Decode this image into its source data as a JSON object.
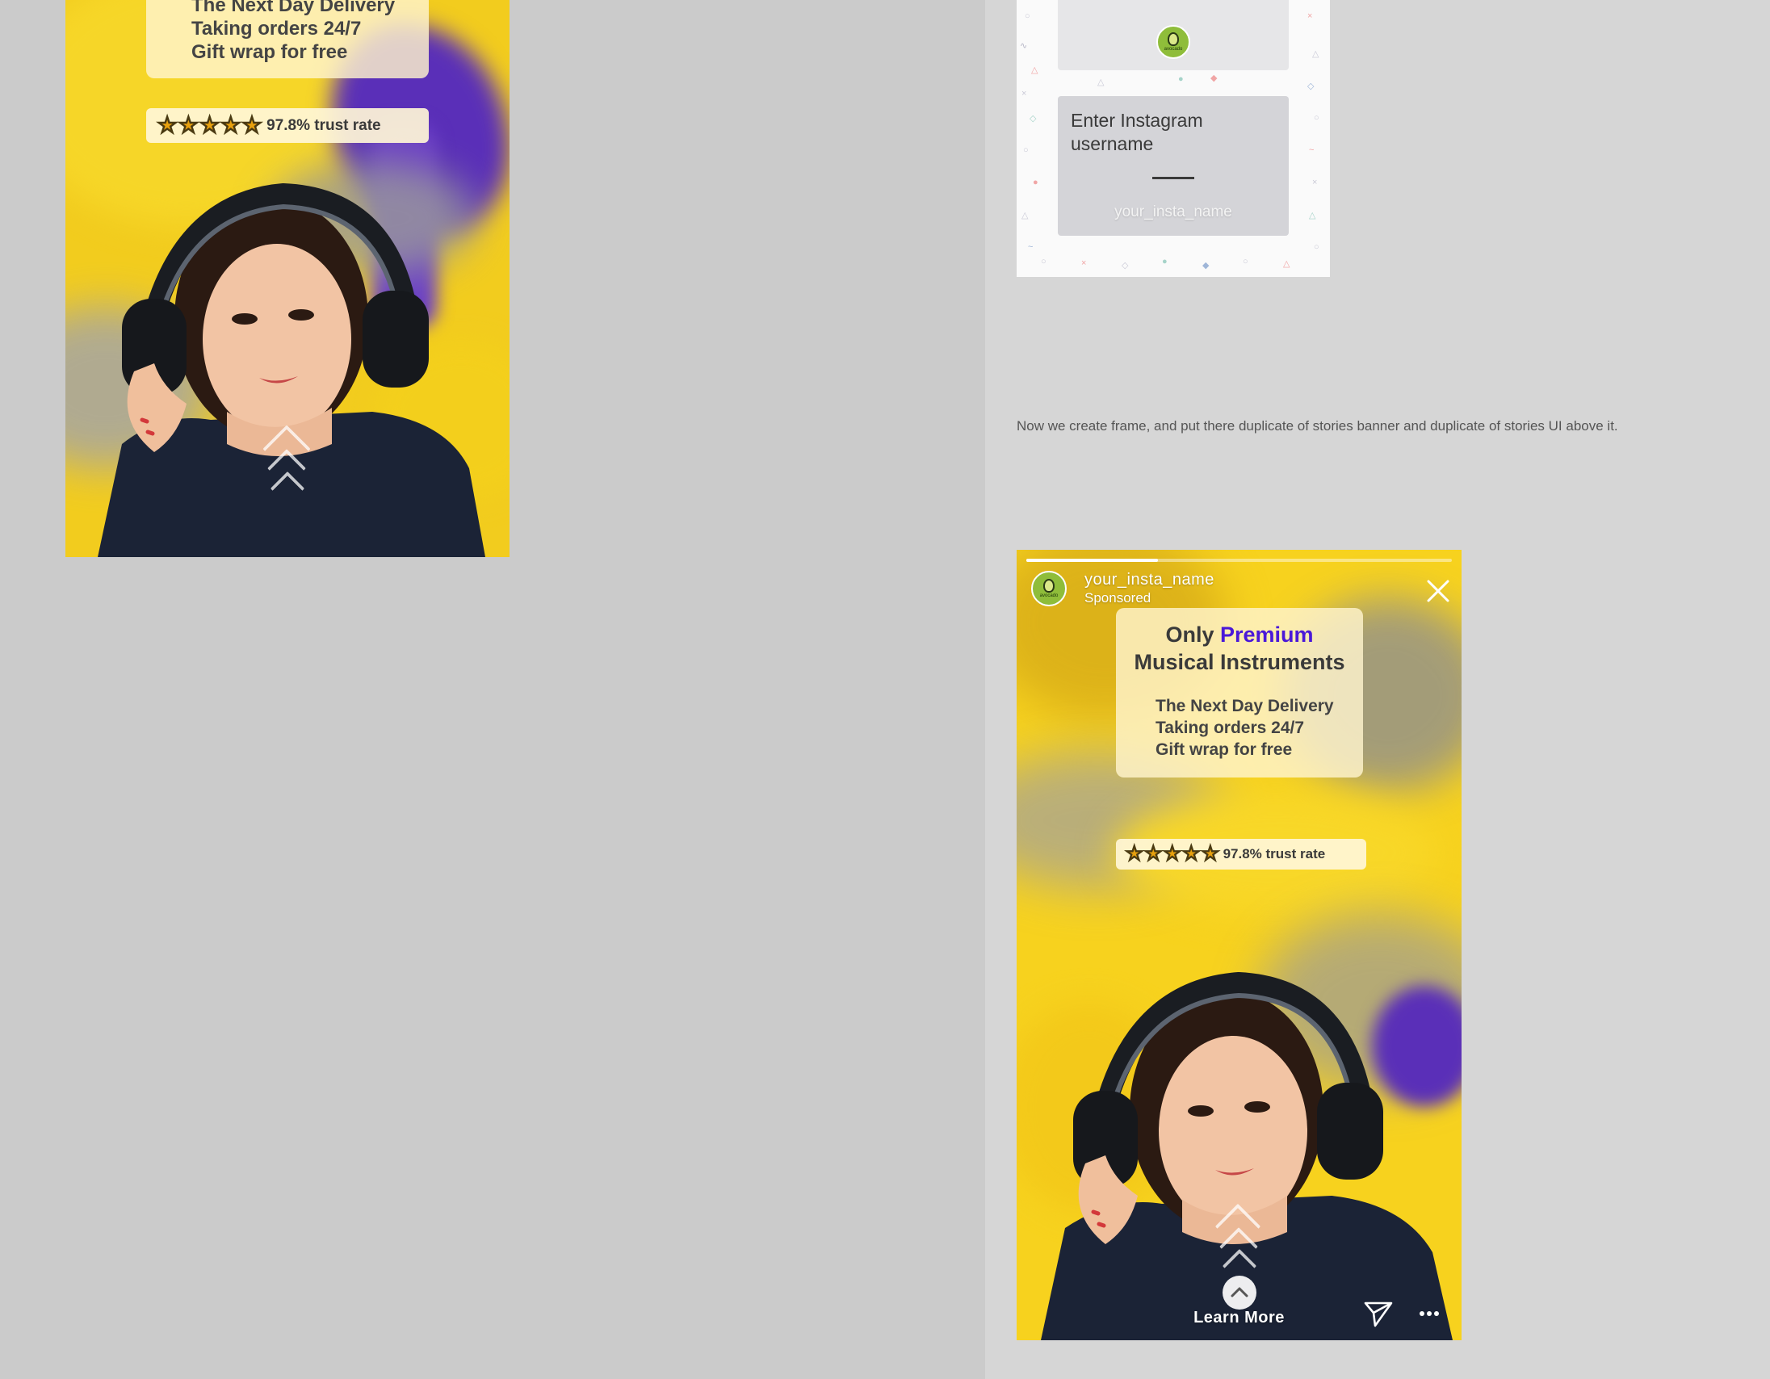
{
  "colors": {
    "canvas_bg": "#cbcbcb",
    "right_panel_bg": "#d6d6d6",
    "story_yellow": "#f7d21e",
    "accent_purple": "#4a18d8",
    "blob_purple": "#5a2fb8",
    "avocado_green": "#8fbd3a"
  },
  "left_banner": {
    "info_lines": [
      "The Next Day Delivery",
      "Taking orders 24/7",
      "Gift wrap for free"
    ],
    "stars": [
      "★",
      "★",
      "★",
      "★",
      "★"
    ],
    "trust_rate": "97.8% trust rate"
  },
  "top_phone": {
    "logo_text": "avocado",
    "prompt_label": "Enter Instagram username",
    "username_value": "your_insta_name"
  },
  "caption": "Now we create frame, and put there duplicate of stories banner and duplicate of stories UI above it.",
  "story": {
    "progress_fraction": 0.31,
    "avatar_logo_text": "avocado",
    "username": "your_insta_name",
    "sponsored": "Sponsored",
    "headline_only": "Only",
    "headline_premium": "Premium",
    "headline_line2": "Musical Instruments",
    "info_lines": [
      "The Next Day Delivery",
      "Taking orders 24/7",
      "Gift wrap for free"
    ],
    "stars": [
      "★",
      "★",
      "★",
      "★",
      "★"
    ],
    "trust_rate": "97.8% trust rate",
    "learn_more": "Learn More",
    "icons": {
      "close": "close-icon",
      "send": "send-icon",
      "more": "more-icon",
      "swipe_up": "chevron-up-icon"
    }
  }
}
